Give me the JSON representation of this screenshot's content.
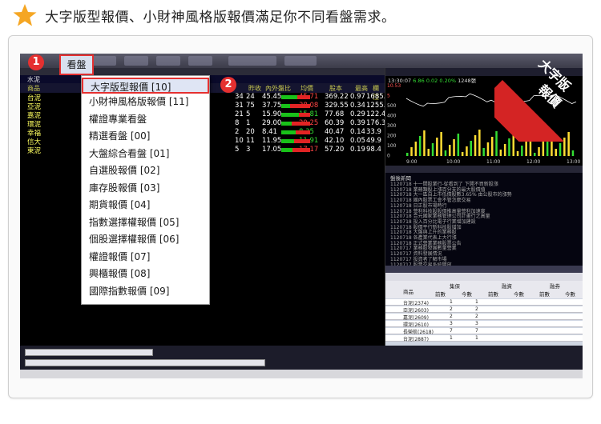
{
  "header": {
    "title": "大字版型報價、小財神風格版報價滿足你不同看盤需求。"
  },
  "menu": {
    "button_label": "看盤",
    "badge_1": "1",
    "badge_2": "2",
    "items": [
      {
        "label": "大字版型報價 [10]"
      },
      {
        "label": "小財神風格版報價 [11]"
      },
      {
        "label": "權證專業看盤"
      },
      {
        "label": "精選看盤 [00]"
      },
      {
        "label": "大盤綜合看盤 [01]"
      },
      {
        "label": "自選股報價 [02]"
      },
      {
        "label": "庫存股報價 [03]"
      },
      {
        "label": "期貨報價 [04]"
      },
      {
        "label": "指數選擇權報價 [05]"
      },
      {
        "label": "個股選擇權報價 [06]"
      },
      {
        "label": "權證報價 [07]"
      },
      {
        "label": "興櫃報價 [08]"
      },
      {
        "label": "國際指數報價 [09]"
      }
    ]
  },
  "ribbon": {
    "line1": "大字版",
    "line2": "報價"
  },
  "left_panel": {
    "title": "水泥",
    "headers": [
      "商品",
      "昨收",
      "內外盤比",
      "均價",
      "股本",
      "最高",
      "欄位"
    ],
    "rows": [
      {
        "name": "台泥",
        "v1": "34",
        "v2": "24",
        "v3": "45.45",
        "v4": "45.71",
        "v5": "369.22",
        "v6": "0.97",
        "v7": "1685.5"
      },
      {
        "name": "亞泥",
        "v1": "31",
        "v2": "75",
        "v3": "37.75",
        "v4": "38.08",
        "v5": "329.55",
        "v6": "0.34",
        "v7": "1255.6"
      },
      {
        "name": "嘉泥",
        "v1": "21",
        "v2": "5",
        "v3": "15.90",
        "v4": "15.81",
        "v5": "77.68",
        "v6": "0.29",
        "v7": "122.4"
      },
      {
        "name": "環泥",
        "v1": "8",
        "v2": "1",
        "v3": "29.00",
        "v4": "29.25",
        "v5": "60.39",
        "v6": "0.39",
        "v7": "176.3"
      },
      {
        "name": "幸福",
        "v1": "2",
        "v2": "20",
        "v3": "8.41",
        "v4": "8.35",
        "v5": "40.47",
        "v6": "0.14",
        "v7": "33.9"
      },
      {
        "name": "信大",
        "v1": "10",
        "v2": "11",
        "v3": "11.95",
        "v4": "11.91",
        "v5": "42.10",
        "v6": "0.05",
        "v7": "49.9"
      },
      {
        "name": "東泥",
        "v1": "5",
        "v2": "3",
        "v3": "17.05",
        "v4": "17.17",
        "v5": "57.20",
        "v6": "0.19",
        "v7": "98.4"
      }
    ]
  },
  "chart": {
    "info": "13:30:07",
    "chg1": "6.86",
    "chg2": "0.02",
    "chg3": "0.20%",
    "vol": "1248張",
    "y_ticks": [
      "10.53",
      "5",
      "500",
      "400",
      "300",
      "200",
      "100",
      "0"
    ],
    "x_ticks": [
      "9:00",
      "10:00",
      "11:00",
      "12:00",
      "13:00"
    ]
  },
  "news": {
    "title": "盤後新聞",
    "lines": [
      "1120718 十一間股業行-從看到了 下開不買新股漲",
      "1120718 業務類股上漲百分支的最大股價值",
      "1120718 大一區自上市低價股數3.65% 由公股市的漲勢",
      "1120718 國內股票工會不管怎麼交易",
      "1120718 日正股市場時行",
      "1120718 營利科技股股價推高量營利加速度",
      "1120718 合元國家業務管理公司計畫行之高量",
      "1120718 投入百分比電子行業增加建設",
      "1120718 股價平行新科技股增加",
      "1120718 大盤與上升的業務股",
      "1120718 各產業代表上大行漲",
      "1120718 正式營業業務股票公告",
      "1120717 業務股發展數量營業",
      "1120717 資料發展情況",
      "1120717 投資者了解市場",
      "1120717 股票交易系統開放"
    ]
  },
  "stats_table": {
    "headers": [
      "商品",
      "集保",
      "融資",
      "融券"
    ],
    "sub_headers": [
      "前數",
      "今數",
      "前數",
      "今數",
      "前數",
      "今數"
    ],
    "rows": [
      {
        "name": "台泥(2374)",
        "a": "1",
        "b": "1"
      },
      {
        "name": "亞泥(2603)",
        "a": "2",
        "b": "2"
      },
      {
        "name": "嘉泥(2609)",
        "a": "2",
        "b": "2"
      },
      {
        "name": "環泥(2610)",
        "a": "3",
        "b": "3"
      },
      {
        "name": "長榮航(2618)",
        "a": "7",
        "b": "7"
      },
      {
        "name": "台泥(2887)",
        "a": "1",
        "b": "1"
      }
    ]
  },
  "colors": {
    "accent_red": "#e53030",
    "star": "#f5a623",
    "up": "#e22424",
    "down": "#19c219"
  }
}
